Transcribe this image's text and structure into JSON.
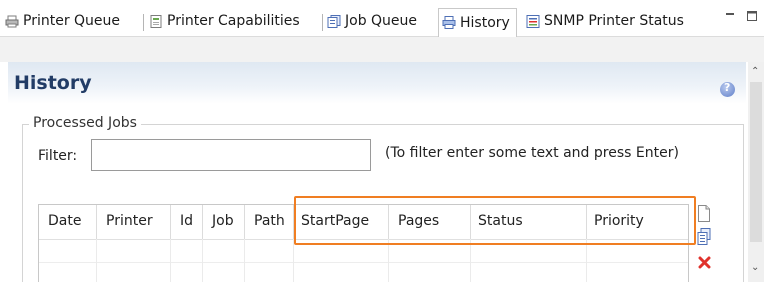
{
  "tabs": [
    {
      "label": "Printer Queue",
      "icon": "printer-queue-icon"
    },
    {
      "label": "Printer Capabilities",
      "icon": "capabilities-icon"
    },
    {
      "label": "Job Queue",
      "icon": "job-queue-icon"
    },
    {
      "label": "History",
      "icon": "history-icon",
      "active": true
    },
    {
      "label": "SNMP Printer Status",
      "icon": "snmp-status-icon"
    }
  ],
  "view": {
    "title": "History",
    "group_label": "Processed Jobs",
    "filter_label": "Filter:",
    "filter_value": "",
    "filter_hint": "(To filter enter some text and press Enter)"
  },
  "table": {
    "columns": [
      "Date",
      "Printer",
      "Id",
      "Job",
      "Path",
      "StartPage",
      "Pages",
      "Status",
      "Priority"
    ],
    "rows": []
  },
  "side_tools": [
    "new-icon",
    "copy-icon",
    "delete-icon"
  ],
  "colors": {
    "accent": "#f07e22",
    "title": "#223c66",
    "delete": "#e0322c"
  }
}
